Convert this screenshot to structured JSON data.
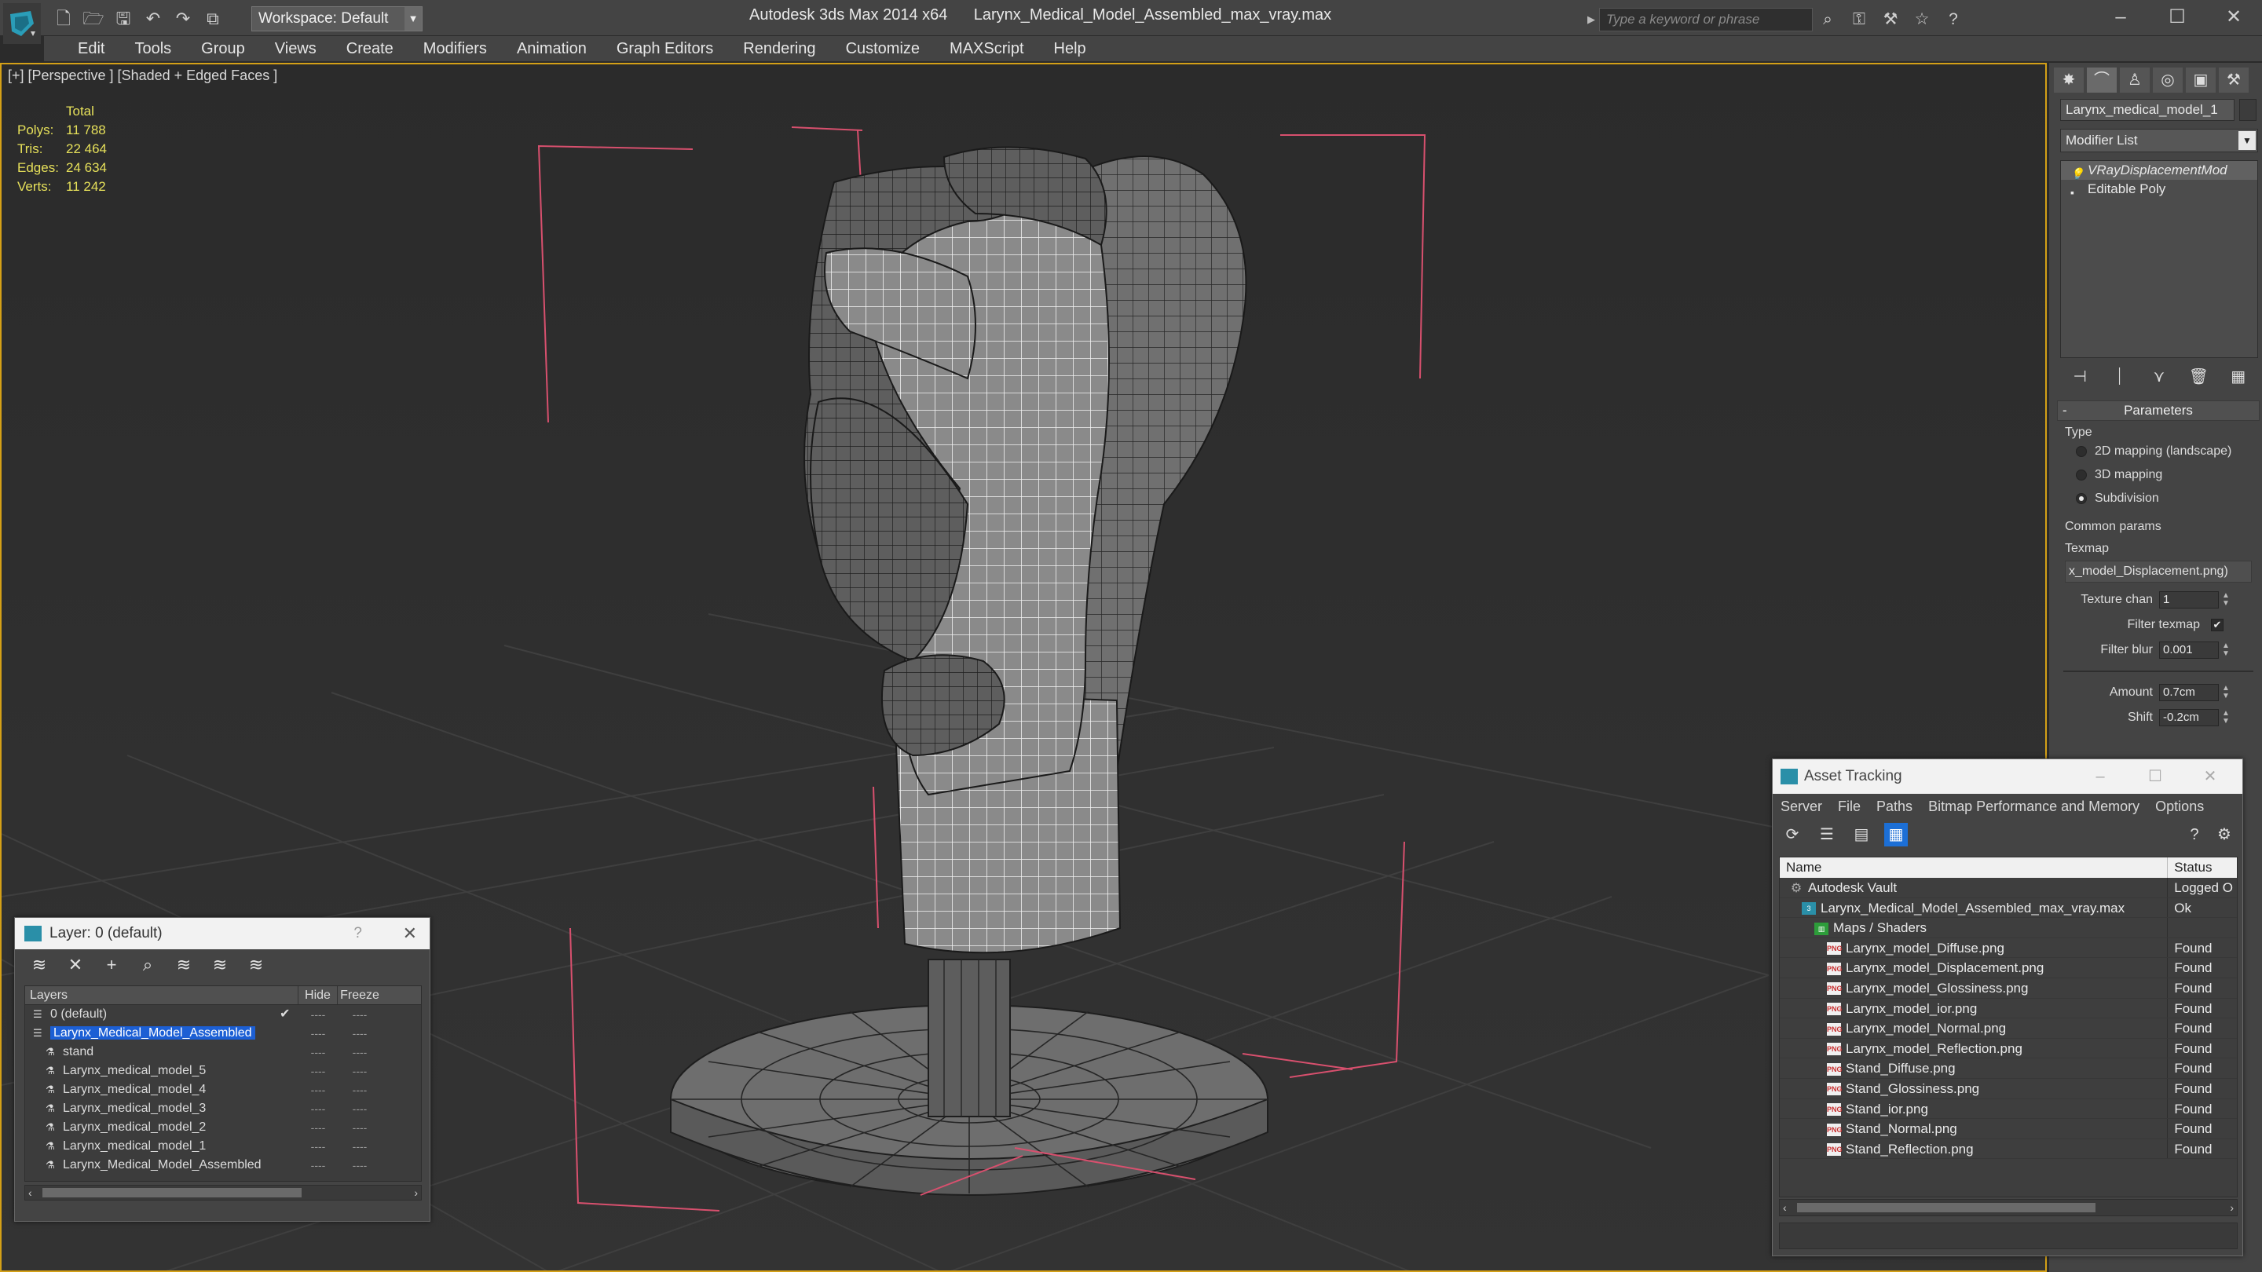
{
  "app": {
    "title": "Autodesk 3ds Max 2014 x64",
    "file": "Larynx_Medical_Model_Assembled_max_vray.max",
    "workspace": "Workspace: Default",
    "search_placeholder": "Type a keyword or phrase"
  },
  "menu": [
    "Edit",
    "Tools",
    "Group",
    "Views",
    "Create",
    "Modifiers",
    "Animation",
    "Graph Editors",
    "Rendering",
    "Customize",
    "MAXScript",
    "Help"
  ],
  "viewport": {
    "label": "[+] [Perspective ] [Shaded + Edged Faces ]",
    "stats": {
      "header": "Total",
      "rows": [
        {
          "k": "Polys:",
          "v": "11 788"
        },
        {
          "k": "Tris:",
          "v": "22 464"
        },
        {
          "k": "Edges:",
          "v": "24 634"
        },
        {
          "k": "Verts:",
          "v": "11 242"
        }
      ]
    }
  },
  "command_panel": {
    "object_name": "Larynx_medical_model_1",
    "modifier_list": "Modifier List",
    "stack": [
      "VRayDisplacementMod",
      "Editable Poly"
    ],
    "params": {
      "title": "Parameters",
      "type_label": "Type",
      "types": [
        "2D mapping (landscape)",
        "3D mapping",
        "Subdivision"
      ],
      "common_label": "Common params",
      "texmap_label": "Texmap",
      "texmap_value": "x_model_Displacement.png)",
      "texture_chan_label": "Texture chan",
      "texture_chan": "1",
      "filter_texmap_label": "Filter texmap",
      "filter_blur_label": "Filter blur",
      "filter_blur": "0.001",
      "amount_label": "Amount",
      "amount": "0.7cm",
      "shift_label": "Shift",
      "shift": "-0.2cm"
    }
  },
  "layer_window": {
    "title": "Layer: 0 (default)",
    "help": "?",
    "columns": [
      "Layers",
      "Hide",
      "Freeze"
    ],
    "rows": [
      {
        "name": "0 (default)",
        "indent": 1,
        "check": "✔"
      },
      {
        "name": "Larynx_Medical_Model_Assembled",
        "indent": 1,
        "check": ""
      },
      {
        "name": "stand",
        "indent": 2,
        "check": ""
      },
      {
        "name": "Larynx_medical_model_5",
        "indent": 2,
        "check": ""
      },
      {
        "name": "Larynx_medical_model_4",
        "indent": 2,
        "check": ""
      },
      {
        "name": "Larynx_medical_model_3",
        "indent": 2,
        "check": ""
      },
      {
        "name": "Larynx_medical_model_2",
        "indent": 2,
        "check": ""
      },
      {
        "name": "Larynx_medical_model_1",
        "indent": 2,
        "check": ""
      },
      {
        "name": "Larynx_Medical_Model_Assembled",
        "indent": 2,
        "check": ""
      }
    ],
    "dash": "----"
  },
  "asset_window": {
    "title": "Asset Tracking",
    "menu": [
      "Server",
      "File",
      "Paths",
      "Bitmap Performance and Memory",
      "Options"
    ],
    "columns": [
      "Name",
      "Status"
    ],
    "rows": [
      {
        "name": "Autodesk Vault",
        "status": "Logged O",
        "indent": 0,
        "icon": "vault"
      },
      {
        "name": "Larynx_Medical_Model_Assembled_max_vray.max",
        "status": "Ok",
        "indent": 1,
        "icon": "max"
      },
      {
        "name": "Maps / Shaders",
        "status": "",
        "indent": 2,
        "icon": "maps"
      },
      {
        "name": "Larynx_model_Diffuse.png",
        "status": "Found",
        "indent": 3,
        "icon": "png"
      },
      {
        "name": "Larynx_model_Displacement.png",
        "status": "Found",
        "indent": 3,
        "icon": "png"
      },
      {
        "name": "Larynx_model_Glossiness.png",
        "status": "Found",
        "indent": 3,
        "icon": "png"
      },
      {
        "name": "Larynx_model_ior.png",
        "status": "Found",
        "indent": 3,
        "icon": "png"
      },
      {
        "name": "Larynx_model_Normal.png",
        "status": "Found",
        "indent": 3,
        "icon": "png"
      },
      {
        "name": "Larynx_model_Reflection.png",
        "status": "Found",
        "indent": 3,
        "icon": "png"
      },
      {
        "name": "Stand_Diffuse.png",
        "status": "Found",
        "indent": 3,
        "icon": "png"
      },
      {
        "name": "Stand_Glossiness.png",
        "status": "Found",
        "indent": 3,
        "icon": "png"
      },
      {
        "name": "Stand_ior.png",
        "status": "Found",
        "indent": 3,
        "icon": "png"
      },
      {
        "name": "Stand_Normal.png",
        "status": "Found",
        "indent": 3,
        "icon": "png"
      },
      {
        "name": "Stand_Reflection.png",
        "status": "Found",
        "indent": 3,
        "icon": "png"
      }
    ],
    "png_tag": "PNG"
  },
  "colors": {
    "ui_bg": "#444444",
    "viewport_bg": "#2d2d2d",
    "stats_text": "#e6e05a",
    "selection": "#1c5fd4",
    "bbox_lines": "#d8506e",
    "viewport_border": "#d4a017"
  }
}
